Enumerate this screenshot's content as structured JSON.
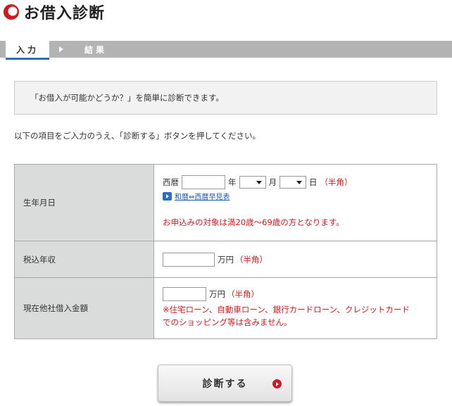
{
  "header": {
    "title": "お借入診断",
    "icon": "red-circle-logo"
  },
  "steps": {
    "active_label": "入力",
    "next_label": "結果"
  },
  "intro": "「お借入が可能かどうか？」を簡単に診断できます。",
  "instruction": "以下の項目をご入力のうえ、「診断する」ボタンを押してください。",
  "form": {
    "birth": {
      "label": "生年月日",
      "era_label": "西暦",
      "year_value": "",
      "year_unit": "年",
      "month_value": "",
      "month_unit": "月",
      "day_value": "",
      "day_unit": "日",
      "hankaku_note": "（半角）",
      "link_text": "和暦⇔西暦早見表",
      "age_note": "お申込みの対象は満20歳～69歳の方となります。"
    },
    "income": {
      "label": "税込年収",
      "value": "",
      "unit": "万円",
      "hankaku_note": "（半角）"
    },
    "debt": {
      "label": "現在他社借入金額",
      "value": "",
      "unit": "万円",
      "hankaku_note": "（半角）",
      "note_line1": "※住宅ローン、自動車ローン、銀行カードローン、クレジットカード",
      "note_line2": "でのショッピング等は含みません。"
    }
  },
  "submit": {
    "label": "診断する"
  },
  "colors": {
    "accent_red": "#d0191f",
    "link_blue": "#1a56b8",
    "step_bar": "#b3b3b3",
    "label_bg": "#dadcdc"
  }
}
